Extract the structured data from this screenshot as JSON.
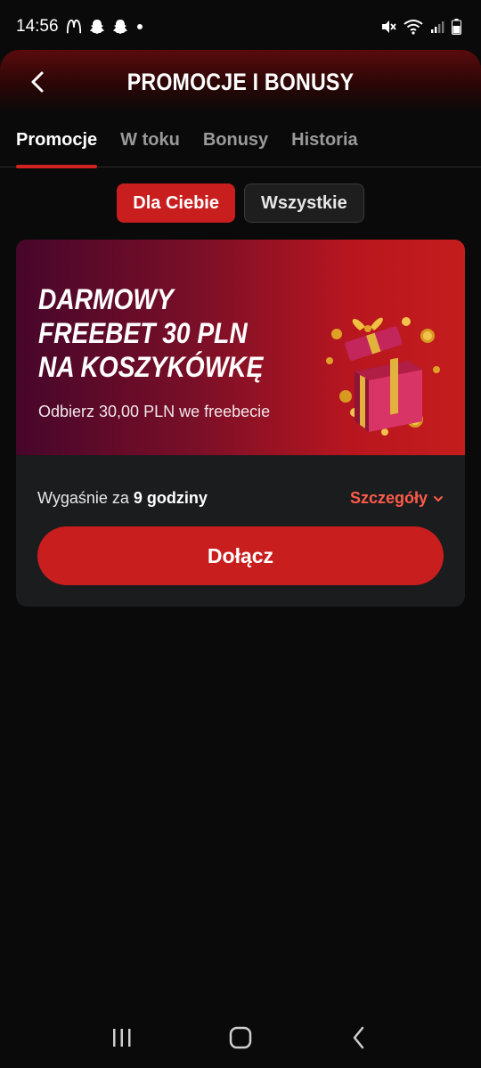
{
  "status_bar": {
    "time": "14:56",
    "icons": [
      "mcdonalds-icon",
      "snapchat-icon",
      "snapchat-icon",
      "dot-icon",
      "mute-icon",
      "wifi-icon",
      "signal-icon",
      "battery-icon"
    ]
  },
  "header": {
    "title": "PROMOCJE I BONUSY",
    "back_icon": "chevron-left-icon"
  },
  "tabs": [
    {
      "label": "Promocje",
      "active": true
    },
    {
      "label": "W toku",
      "active": false
    },
    {
      "label": "Bonusy",
      "active": false
    },
    {
      "label": "Historia",
      "active": false
    }
  ],
  "filters": [
    {
      "label": "Dla Ciebie",
      "selected": true
    },
    {
      "label": "Wszystkie",
      "selected": false
    }
  ],
  "promo": {
    "title": "DARMOWY FREEBET 30 PLN NA KOSZYKÓWKĘ",
    "subtitle": "Odbierz 30,00 PLN we freebecie",
    "expiry_prefix": "Wygaśnie za",
    "expiry_value": "9 godziny",
    "details_label": "Szczegóły",
    "join_label": "Dołącz",
    "image": "gift-box-coins-icon"
  },
  "colors": {
    "accent": "#c81e1e",
    "details": "#ff5b4a",
    "background": "#0a0a0a",
    "card": "#1b1c1e"
  },
  "nav": {
    "icons": [
      "recent-apps-icon",
      "home-icon",
      "back-icon"
    ]
  }
}
